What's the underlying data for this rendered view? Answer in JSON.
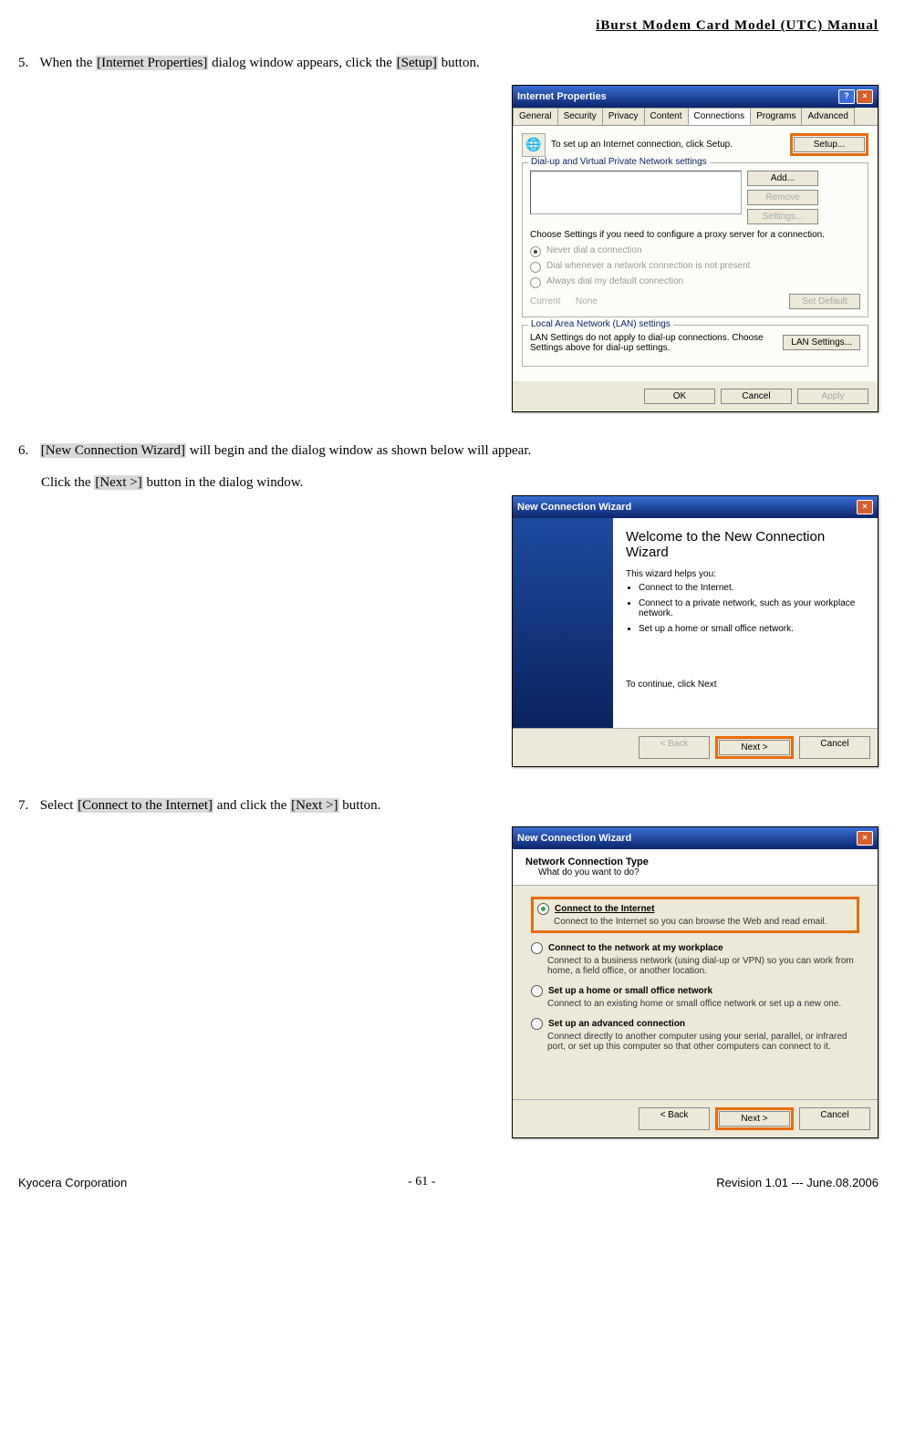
{
  "header": {
    "title": "iBurst  Modem  Card  Model  (UTC)  Manual"
  },
  "step5": {
    "num": "5.",
    "pre": "When the ",
    "hl1": "[Internet Properties]",
    "mid": " dialog window appears, click the ",
    "hl2": "[Setup]",
    "post": " button."
  },
  "dialog1": {
    "title": "Internet Properties",
    "tabs": [
      "General",
      "Security",
      "Privacy",
      "Content",
      "Connections",
      "Programs",
      "Advanced"
    ],
    "setupText": "To set up an Internet connection, click Setup.",
    "setupBtn": "Setup...",
    "fs1": {
      "legend": "Dial-up and Virtual Private Network settings",
      "add": "Add...",
      "remove": "Remove",
      "settings": "Settings...",
      "choose": "Choose Settings if you need to configure a proxy server for a connection.",
      "r1": "Never dial a connection",
      "r2": "Dial whenever a network connection is not present",
      "r3": "Always dial my default connection",
      "currentLabel": "Current",
      "currentValue": "None",
      "setDefault": "Set Default"
    },
    "fs2": {
      "legend": "Local Area Network (LAN) settings",
      "text": "LAN Settings do not apply to dial-up connections. Choose Settings above for dial-up settings.",
      "btn": "LAN Settings..."
    },
    "ok": "OK",
    "cancel": "Cancel",
    "apply": "Apply"
  },
  "step6": {
    "num": "6.",
    "pre": "  ",
    "hl1": "[New Connection Wizard]",
    "mid": " will begin and the dialog window as shown below will appear.",
    "line2a": "Click the ",
    "hl2": "[Next >]",
    "line2b": " button in the dialog window."
  },
  "dialog2": {
    "title": "New Connection Wizard",
    "heading": "Welcome to the New Connection Wizard",
    "helps": "This wizard helps you:",
    "b1": "Connect to the Internet.",
    "b2": "Connect to a private network, such as your workplace network.",
    "b3": "Set up a home or small office network.",
    "continue": "To continue, click Next",
    "back": "< Back",
    "next": "Next >",
    "cancel": "Cancel"
  },
  "step7": {
    "num": "7.",
    "pre": "Select ",
    "hl1": "[Connect to the Internet]",
    "mid": " and click the ",
    "hl2": "[Next >]",
    "post": " button."
  },
  "dialog3": {
    "title": "New Connection Wizard",
    "headerTitle": "Network Connection Type",
    "headerSub": "What do you want to do?",
    "opt1": {
      "label": "Connect to the Internet",
      "desc": "Connect to the Internet so you can browse the Web and read email."
    },
    "opt2": {
      "label": "Connect to the network at my workplace",
      "desc": "Connect to a business network (using dial-up or VPN) so you can work from home, a field office, or another location."
    },
    "opt3": {
      "label": "Set up a home or small office network",
      "desc": "Connect to an existing home or small office network or set up a new one."
    },
    "opt4": {
      "label": "Set up an advanced connection",
      "desc": "Connect directly to another computer using your serial, parallel, or infrared port, or set up this computer so that other computers can connect to it."
    },
    "back": "< Back",
    "next": "Next >",
    "cancel": "Cancel"
  },
  "footer": {
    "left": "Kyocera Corporation",
    "center": "- 61 -",
    "right": "Revision 1.01 --- June.08.2006"
  }
}
